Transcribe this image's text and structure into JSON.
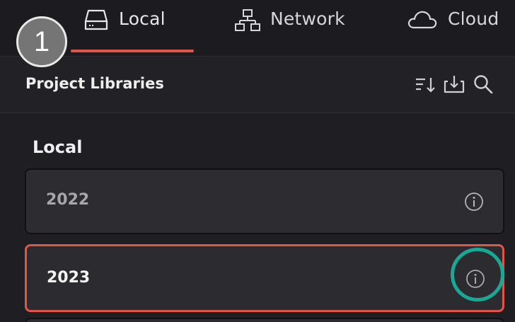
{
  "tabs": [
    {
      "label": "Local",
      "icon": "drive-icon",
      "active": true
    },
    {
      "label": "Network",
      "icon": "network-icon",
      "active": false
    },
    {
      "label": "Cloud",
      "icon": "cloud-icon",
      "active": false
    }
  ],
  "step_badge": "1",
  "header": {
    "title": "Project Libraries",
    "icons": [
      "sort-icon",
      "import-icon",
      "search-icon"
    ]
  },
  "section": {
    "label": "Local",
    "libraries": [
      {
        "name": "2022",
        "selected": false
      },
      {
        "name": "2023",
        "selected": true
      }
    ]
  },
  "colors": {
    "accent": "#e0544a",
    "highlight_ring": "#1aa896",
    "background": "#1f1f23",
    "row_background": "#2c2c31"
  }
}
